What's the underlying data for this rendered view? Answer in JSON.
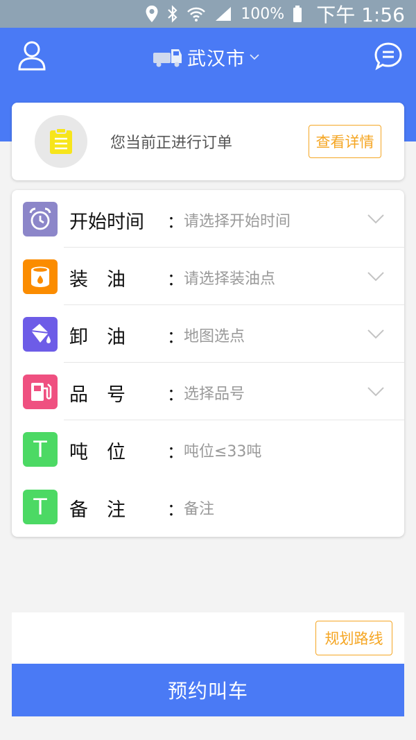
{
  "status_bar": {
    "battery_percent": "100%",
    "time": "下午 1:56",
    "icons": [
      "location-icon",
      "bluetooth-icon",
      "wifi-icon",
      "signal-icon",
      "battery-icon"
    ]
  },
  "header": {
    "city": "武汉市",
    "icons": {
      "left": "user-icon",
      "right": "message-icon",
      "city": "truck-icon"
    }
  },
  "order_banner": {
    "text": "您当前正进行订单",
    "button_label": "查看详情"
  },
  "form": {
    "rows": [
      {
        "label": "开始时间",
        "value": "请选择开始时间",
        "icon": "alarm-clock-icon",
        "icon_color": "#8c86c9",
        "has_dropdown": true
      },
      {
        "label": "装　油",
        "value": "请选择装油点",
        "icon": "oil-barrel-icon",
        "icon_color": "#fb8c00",
        "has_dropdown": true
      },
      {
        "label": "卸　油",
        "value": "地图选点",
        "icon": "paint-bucket-icon",
        "icon_color": "#6d5ce7",
        "has_dropdown": true
      },
      {
        "label": "品　号",
        "value": "选择品号",
        "icon": "fuel-pump-icon",
        "icon_color": "#ef5080",
        "has_dropdown": true
      },
      {
        "label": "吨　位",
        "value": "吨位≤33吨",
        "icon": "t-letter-icon",
        "icon_color": "#4cd964",
        "icon_text": "T",
        "has_dropdown": false
      },
      {
        "label": "备　注",
        "value": "备注",
        "icon": "t-letter-icon",
        "icon_color": "#4cd964",
        "icon_text": "T",
        "has_dropdown": false
      }
    ],
    "colon": "："
  },
  "route_button_label": "规划路线",
  "book_button_label": "预约叫车",
  "colors": {
    "primary": "#4a7af5",
    "accent_orange": "#f5a623",
    "status_bar": "#8ea3b4"
  }
}
